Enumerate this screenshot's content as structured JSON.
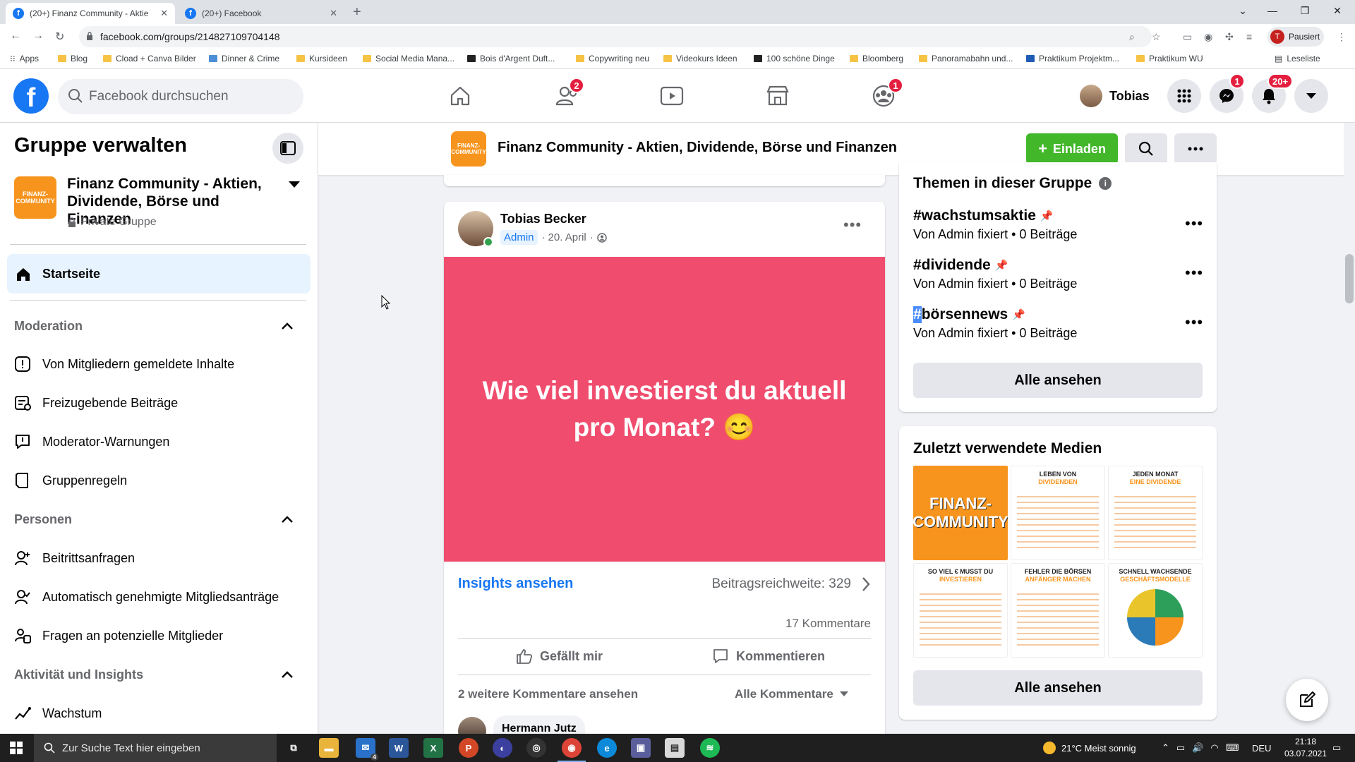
{
  "browser": {
    "tabs": [
      {
        "title": "(20+) Finanz Community - Aktie",
        "active": true
      },
      {
        "title": "(20+) Facebook",
        "active": false
      }
    ],
    "url": "facebook.com/groups/214827109704148",
    "profile_status": "Pausiert",
    "profile_initial": "T",
    "bookmarks": [
      "Apps",
      "Blog",
      "Cload + Canva Bilder",
      "Dinner & Crime",
      "Kursideen",
      "Social Media Mana...",
      "Bois d'Argent Duft...",
      "Copywriting neu",
      "Videokurs Ideen",
      "100 schöne Dinge",
      "Bloomberg",
      "Panoramabahn und...",
      "Praktikum Projektm...",
      "Praktikum WU"
    ],
    "reading_list": "Leseliste"
  },
  "fb_header": {
    "logo": "f",
    "search_placeholder": "Facebook durchsuchen",
    "nav": [
      {
        "icon": "home-icon",
        "badge": ""
      },
      {
        "icon": "friends-icon",
        "badge": "2"
      },
      {
        "icon": "watch-icon",
        "badge": ""
      },
      {
        "icon": "marketplace-icon",
        "badge": ""
      },
      {
        "icon": "groups-icon",
        "badge": "1"
      }
    ],
    "user_name": "Tobias",
    "messenger_badge": "1",
    "notifications_badge": "20+"
  },
  "sidebar": {
    "title": "Gruppe verwalten",
    "group_name": "Finanz Community - Aktien, Dividende, Börse und Finanzen",
    "group_privacy": "Private Gruppe",
    "group_thumb_text": "FINANZ-COMMUNITY",
    "home": "Startseite",
    "sections": [
      {
        "title": "Moderation",
        "items": [
          "Von Mitgliedern gemeldete Inhalte",
          "Freizugebende Beiträge",
          "Moderator-Warnungen",
          "Gruppenregeln"
        ]
      },
      {
        "title": "Personen",
        "items": [
          "Beitrittsanfragen",
          "Automatisch genehmigte Mitgliedsanträge",
          "Fragen an potenzielle Mitglieder"
        ]
      },
      {
        "title": "Aktivität und Insights",
        "items": [
          "Wachstum"
        ]
      }
    ]
  },
  "group_header": {
    "title": "Finanz Community - Aktien, Dividende, Börse und Finanzen",
    "invite_label": "Einladen"
  },
  "post": {
    "author": "Tobias Becker",
    "role": "Admin",
    "date": "20. April",
    "image_text": "Wie viel investierst du aktuell pro Monat? 😊",
    "insights_label": "Insights ansehen",
    "reach": "Beitragsreichweite: 329",
    "comments_count": "17 Kommentare",
    "like_label": "Gefällt mir",
    "comment_label": "Kommentieren",
    "more_comments": "2 weitere Kommentare ansehen",
    "all_comments": "Alle Kommentare",
    "first_commenter": "Hermann Jutz"
  },
  "topics": {
    "title": "Themen in dieser Gruppe",
    "items": [
      {
        "name": "#wachstumsaktie",
        "sub": "Von Admin fixiert • 0 Beiträge"
      },
      {
        "name": "#dividende",
        "sub": "Von Admin fixiert • 0 Beiträge"
      },
      {
        "name": "börsennews",
        "sub": "Von Admin fixiert • 0 Beiträge"
      }
    ],
    "highlight_prefix": "#",
    "see_all": "Alle ansehen"
  },
  "media": {
    "title": "Zuletzt verwendete Medien",
    "thumbs": [
      {
        "line1": "FINANZ-",
        "line2": "COMMUNITY"
      },
      {
        "line1": "LEBEN VON",
        "line2": "DIVIDENDEN"
      },
      {
        "line1": "JEDEN MONAT",
        "line2": "EINE DIVIDENDE"
      },
      {
        "line1": "SO VIEL € MUSST DU",
        "line2": "INVESTIEREN"
      },
      {
        "line1": "FEHLER DIE BÖRSEN",
        "line2": "ANFÄNGER MACHEN"
      },
      {
        "line1": "SCHNELL WACHSENDE",
        "line2": "GESCHÄFTSMODELLE"
      }
    ],
    "see_all": "Alle ansehen"
  },
  "taskbar": {
    "search_placeholder": "Zur Suche Text hier eingeben",
    "weather": "21°C  Meist sonnig",
    "language": "DEU",
    "time": "21:18",
    "date": "03.07.2021",
    "mail_badge": "4"
  }
}
